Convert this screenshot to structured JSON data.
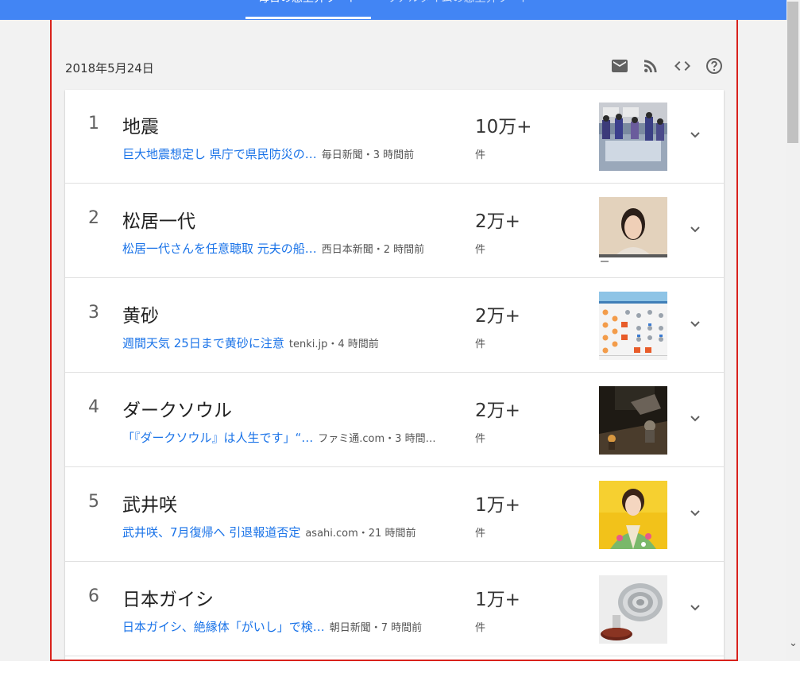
{
  "header": {
    "tabs": [
      {
        "label": "毎日の急上昇ワード",
        "active": true
      },
      {
        "label": "リアルタイムの急上昇ワード",
        "active": false
      }
    ]
  },
  "date": "2018年5月24日",
  "toolbar": {
    "icons": [
      "mail-icon",
      "rss-icon",
      "embed-code-icon",
      "help-icon"
    ]
  },
  "trends": [
    {
      "rank": "1",
      "title": "地震",
      "article": "巨大地震想定し 県庁で県民防災の…",
      "source": "毎日新聞・3 時間前",
      "count": "10万+",
      "unit": "件"
    },
    {
      "rank": "2",
      "title": "松居一代",
      "article": "松居一代さんを任意聴取 元夫の船…",
      "source": "西日本新聞・2 時間前",
      "count": "2万+",
      "unit": "件"
    },
    {
      "rank": "3",
      "title": "黄砂",
      "article": "週間天気 25日まで黄砂に注意",
      "source": "tenki.jp・4 時間前",
      "count": "2万+",
      "unit": "件"
    },
    {
      "rank": "4",
      "title": "ダークソウル",
      "article": "「『ダークソウル』は人生です」“…",
      "source": "ファミ通.com・3 時間…",
      "count": "2万+",
      "unit": "件"
    },
    {
      "rank": "5",
      "title": "武井咲",
      "article": "武井咲、7月復帰へ 引退報道否定",
      "source": "asahi.com・21 時間前",
      "count": "1万+",
      "unit": "件"
    },
    {
      "rank": "6",
      "title": "日本ガイシ",
      "article": "日本ガイシ、絶縁体「がいし」で検…",
      "source": "朝日新聞・7 時間前",
      "count": "1万+",
      "unit": "件"
    }
  ],
  "colors": {
    "topbar": "#4285f4",
    "link": "#1a73e8",
    "frame_border": "#d9221c"
  }
}
